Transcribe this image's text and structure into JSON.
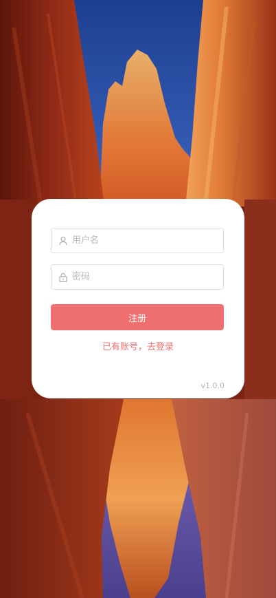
{
  "form": {
    "username_placeholder": "用户名",
    "password_placeholder": "密码",
    "register_label": "注册",
    "login_link": "已有账号，去登录",
    "version": "v1.0.0"
  },
  "icons": {
    "username": "user-icon",
    "password": "lock-icon"
  },
  "colors": {
    "accent": "#f07071",
    "border": "#dcdfe6",
    "placeholder": "#b7b9bf",
    "version": "#b0b3b8"
  }
}
